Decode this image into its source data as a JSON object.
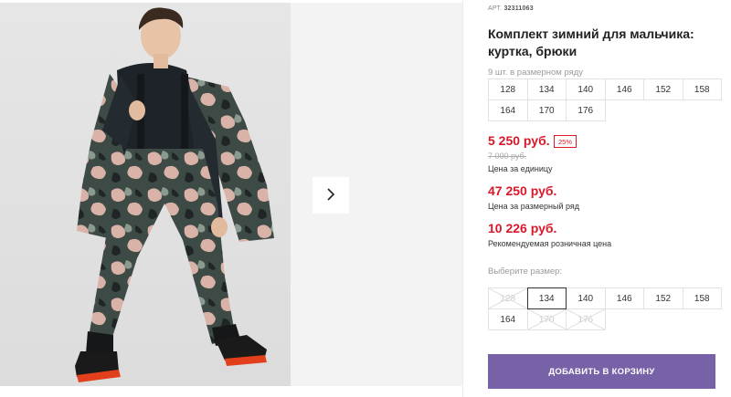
{
  "gallery": {
    "image_alt": "",
    "next_icon": "chevron-right-icon"
  },
  "product": {
    "sku_label": "АРТ.",
    "sku_value": "32311063",
    "title": "Комплект зимний для мальчика: куртка, брюки"
  },
  "size_run": {
    "hint": "9 шт. в размерном ряду",
    "sizes": [
      "128",
      "134",
      "140",
      "146",
      "152",
      "158",
      "164",
      "170",
      "176"
    ]
  },
  "pricing": {
    "unit_price": "5 250 руб.",
    "discount_badge": "25%",
    "old_price": "7 000 руб.",
    "unit_caption": "Цена за единицу",
    "run_price": "47 250 руб.",
    "run_caption": "Цена за размерный ряд",
    "retail_price": "10 226 руб.",
    "retail_caption": "Рекомендуемая розничная цена"
  },
  "size_select": {
    "label": "Выберите размер:",
    "sizes": [
      {
        "label": "128",
        "state": "disabled"
      },
      {
        "label": "134",
        "state": "selected"
      },
      {
        "label": "140",
        "state": "available"
      },
      {
        "label": "146",
        "state": "available"
      },
      {
        "label": "152",
        "state": "available"
      },
      {
        "label": "158",
        "state": "available"
      },
      {
        "label": "164",
        "state": "available"
      },
      {
        "label": "170",
        "state": "disabled"
      },
      {
        "label": "176",
        "state": "disabled"
      }
    ]
  },
  "cart": {
    "button_label": "ДОБАВИТЬ В КОРЗИНУ"
  },
  "colors": {
    "accent": "#7762a8",
    "price_red": "#d8192a"
  }
}
